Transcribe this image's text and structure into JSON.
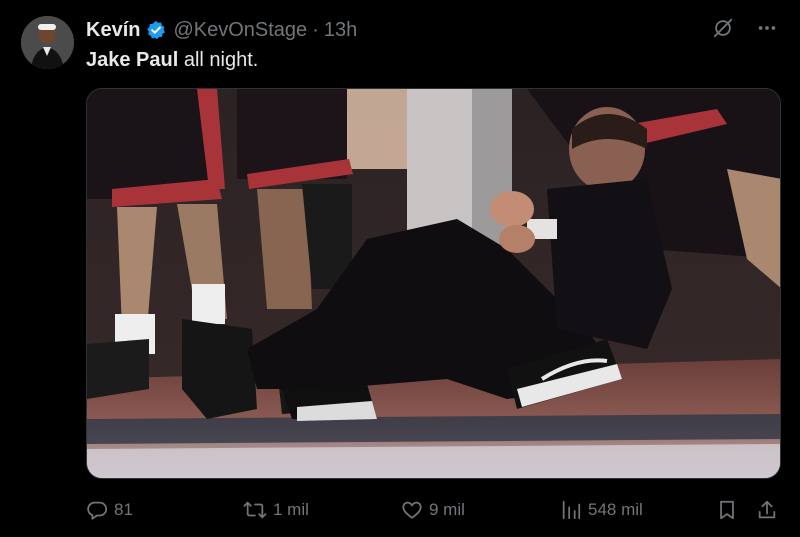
{
  "tweet": {
    "author": {
      "display_name": "Kevín",
      "verified": true,
      "handle": "@KevOnStage",
      "separator": "·",
      "time": "13h",
      "avatar_icon": "profile-photo"
    },
    "text_bold": "Jake Paul",
    "text_rest": " all night.",
    "media": {
      "type": "photo"
    },
    "stats": {
      "replies": "81",
      "reposts": "1 mil",
      "likes": "9 mil",
      "views": "548 mil"
    },
    "icons": {
      "verified": "verified-badge-icon",
      "grok": "grok-icon",
      "more": "more-icon",
      "reply": "reply-icon",
      "repost": "repost-icon",
      "like": "heart-icon",
      "views": "views-icon",
      "bookmark": "bookmark-icon",
      "share": "share-icon"
    }
  },
  "colors": {
    "background": "#000000",
    "text_primary": "#e7e9ea",
    "text_secondary": "#71767b",
    "verified_blue": "#1d9bf0",
    "border": "#2f3336"
  }
}
